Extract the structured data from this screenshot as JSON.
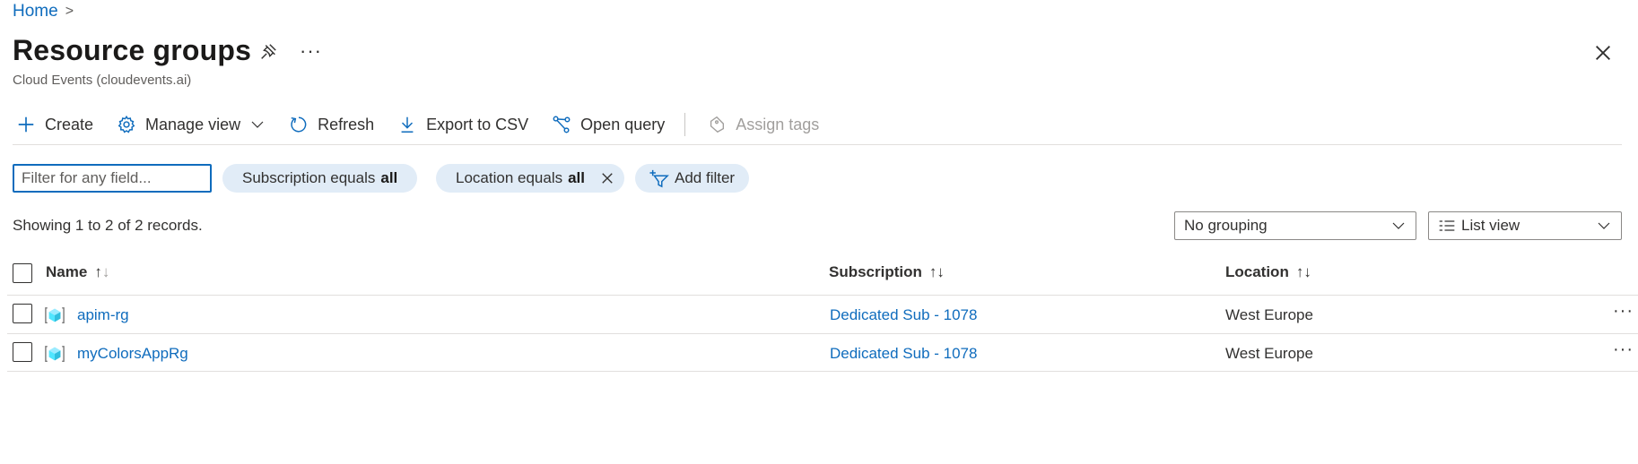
{
  "breadcrumb": {
    "home": "Home",
    "separator": ">"
  },
  "page": {
    "title": "Resource groups",
    "subtitle": "Cloud Events (cloudevents.ai)",
    "more": "···"
  },
  "toolbar": {
    "create": "Create",
    "manage_view": "Manage view",
    "refresh": "Refresh",
    "export_csv": "Export to CSV",
    "open_query": "Open query",
    "assign_tags": "Assign tags"
  },
  "filters": {
    "placeholder": "Filter for any field...",
    "subscription_prefix": "Subscription equals",
    "subscription_value": "all",
    "location_prefix": "Location equals",
    "location_value": "all",
    "add_filter": "Add filter"
  },
  "summary": {
    "showing": "Showing 1 to 2 of 2 records."
  },
  "grouping": {
    "selected": "No grouping"
  },
  "view": {
    "selected": "List view"
  },
  "table": {
    "columns": {
      "name": "Name",
      "subscription": "Subscription",
      "location": "Location"
    },
    "rows": [
      {
        "name": "apim-rg",
        "subscription": "Dedicated Sub - 1078",
        "location": "West Europe",
        "more": "···"
      },
      {
        "name": "myColorsAppRg",
        "subscription": "Dedicated Sub - 1078",
        "location": "West Europe",
        "more": "···"
      }
    ]
  },
  "colors": {
    "accent": "#0f6cbd",
    "pill_bg": "#e1ecf7",
    "text": "#323130",
    "divider": "#e1dfdd"
  }
}
